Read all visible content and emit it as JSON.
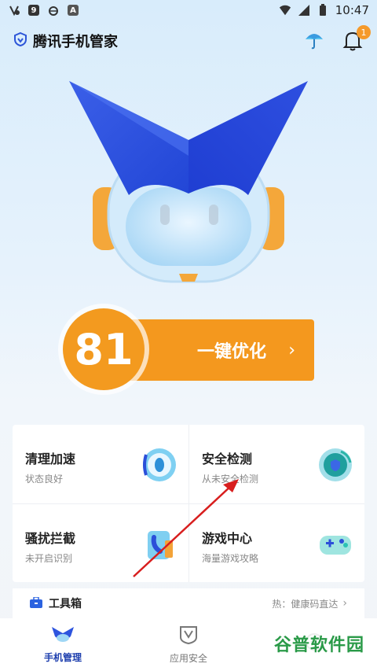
{
  "status_bar": {
    "time": "10:47"
  },
  "header": {
    "title": "腾讯手机管家",
    "notification_count": "1"
  },
  "score": {
    "value": "81"
  },
  "optimize": {
    "label": "一键优化",
    "chevron": "›"
  },
  "cards": [
    {
      "title": "清理加速",
      "subtitle": "状态良好",
      "icon": "fan-icon"
    },
    {
      "title": "安全检测",
      "subtitle": "从未安全检测",
      "icon": "shield-scan-icon"
    },
    {
      "title": "骚扰拦截",
      "subtitle": "未开启识别",
      "icon": "phone-block-icon"
    },
    {
      "title": "游戏中心",
      "subtitle": "海量游戏攻略",
      "icon": "gamepad-icon"
    }
  ],
  "toolbox": {
    "label": "工具箱",
    "hot": "热：健康码直达",
    "chevron": "›"
  },
  "nav": [
    {
      "label": "手机管理",
      "active": true
    },
    {
      "label": "应用安全",
      "active": false
    },
    {
      "label": "",
      "active": false
    }
  ],
  "watermark": "谷普软件园",
  "colors": {
    "accent": "#f4981e",
    "brand_blue": "#1e3fae",
    "window_bg": "#d8ecfb"
  }
}
